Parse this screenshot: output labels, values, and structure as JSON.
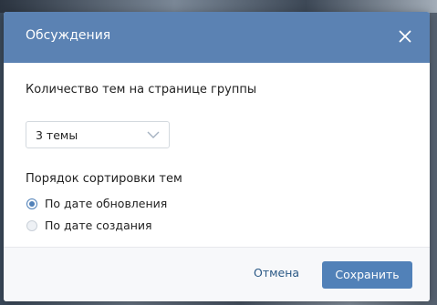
{
  "dialog": {
    "title": "Обсуждения",
    "close_icon": "close-icon"
  },
  "topics_count": {
    "label": "Количество тем на странице группы",
    "selected": "3 темы",
    "chevron_icon": "chevron-down-icon"
  },
  "sort_order": {
    "label": "Порядок сортировки тем",
    "options": [
      {
        "label": "По дате обновления",
        "checked": true
      },
      {
        "label": "По дате создания",
        "checked": false
      }
    ]
  },
  "footer": {
    "cancel_label": "Отмена",
    "save_label": "Сохранить"
  },
  "colors": {
    "header_bg": "#5b82b3",
    "accent": "#5181b8",
    "link": "#2a5885"
  }
}
